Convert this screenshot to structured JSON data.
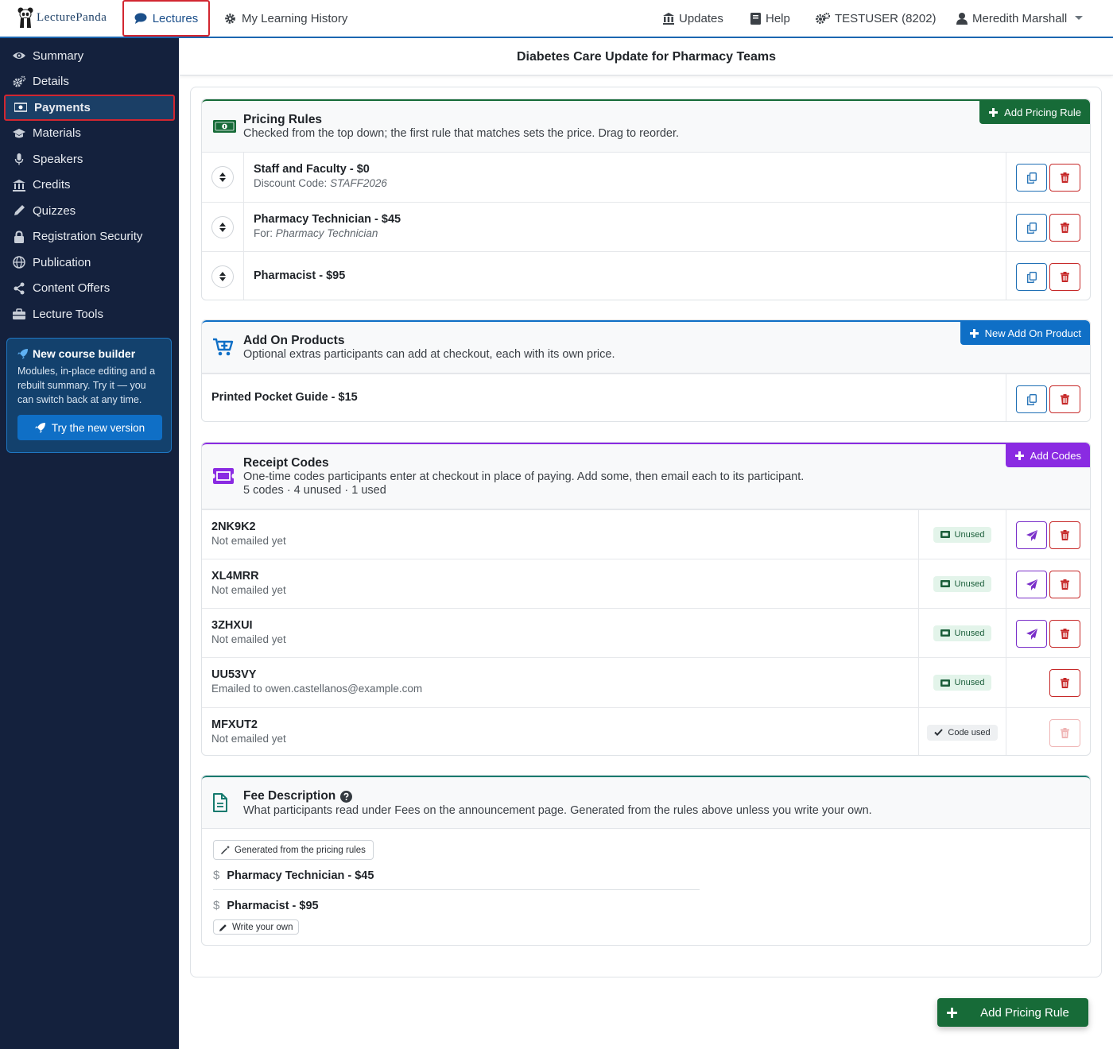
{
  "topnav": {
    "logo": "LecturePanda",
    "tabs": {
      "lectures": "Lectures",
      "history": "My Learning History"
    },
    "right": {
      "updates": "Updates",
      "help": "Help",
      "org": "TESTUSER (8202)",
      "user": "Meredith Marshall"
    }
  },
  "sidebar": {
    "items": [
      {
        "label": "Summary",
        "icon": "eye-icon"
      },
      {
        "label": "Details",
        "icon": "cogs-icon"
      },
      {
        "label": "Payments",
        "icon": "money-icon"
      },
      {
        "label": "Materials",
        "icon": "graduation-cap-icon"
      },
      {
        "label": "Speakers",
        "icon": "microphone-icon"
      },
      {
        "label": "Credits",
        "icon": "bank-icon"
      },
      {
        "label": "Quizzes",
        "icon": "pencil-icon"
      },
      {
        "label": "Registration Security",
        "icon": "lock-icon"
      },
      {
        "label": "Publication",
        "icon": "globe-icon"
      },
      {
        "label": "Content Offers",
        "icon": "share-icon"
      },
      {
        "label": "Lecture Tools",
        "icon": "toolbox-icon"
      }
    ],
    "promo": {
      "title": "New course builder",
      "text": "Modules, in-place editing and a rebuilt summary. Try it — you can switch back at any time.",
      "button": "Try the new version"
    }
  },
  "page_title": "Diabetes Care Update for Pharmacy Teams",
  "pricing": {
    "title": "Pricing Rules",
    "subtitle": "Checked from the top down; the first rule that matches sets the price. Drag to reorder.",
    "add_button": "Add Pricing Rule",
    "rules": [
      {
        "title": "Staff and Faculty - $0",
        "sub_label": "Discount Code:",
        "sub_value": "STAFF2026"
      },
      {
        "title": "Pharmacy Technician - $45",
        "sub_label": "For:",
        "sub_value": "Pharmacy Technician"
      },
      {
        "title": "Pharmacist - $95",
        "sub_label": "",
        "sub_value": ""
      }
    ]
  },
  "addons": {
    "title": "Add On Products",
    "subtitle": "Optional extras participants can add at checkout, each with its own price.",
    "add_button": "New Add On Product",
    "items": [
      {
        "title": "Printed Pocket Guide - $15"
      }
    ]
  },
  "receipts": {
    "title": "Receipt Codes",
    "subtitle": "One-time codes participants enter at checkout in place of paying. Add some, then email each to its participant.",
    "counts": "5 codes · 4 unused · 1 used",
    "add_button": "Add Codes",
    "codes": [
      {
        "code": "2NK9K2",
        "status": "Not emailed yet",
        "badge": "Unused"
      },
      {
        "code": "XL4MRR",
        "status": "Not emailed yet",
        "badge": "Unused"
      },
      {
        "code": "3ZHXUI",
        "status": "Not emailed yet",
        "badge": "Unused"
      },
      {
        "code": "UU53VY",
        "status": "Emailed to owen.castellanos@example.com",
        "badge": "Unused"
      },
      {
        "code": "MFXUT2",
        "status": "Not emailed yet",
        "badge": "Code used"
      }
    ]
  },
  "fees": {
    "title": "Fee Description",
    "subtitle": "What participants read under Fees on the announcement page. Generated from the rules above unless you write your own.",
    "generated_chip": "Generated from the pricing rules",
    "lines": [
      "Pharmacy Technician - $45",
      "Pharmacist - $95"
    ],
    "write_chip": "Write your own"
  },
  "fab": {
    "label": "Add Pricing Rule"
  },
  "colors": {
    "sidebar": "#14213d",
    "primary": "#1b66b0",
    "green": "#176b38",
    "purple": "#8a2be2",
    "teal": "#157a6e",
    "danger": "#c62828"
  }
}
